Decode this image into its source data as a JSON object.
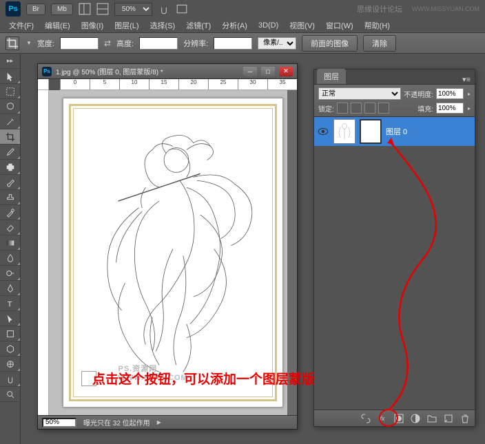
{
  "header": {
    "logo": "Ps",
    "br": "Br",
    "mb": "Mb",
    "zoom": "50%",
    "brand": "思缘设计论坛",
    "brand_url": "WWW.MISSYUAN.COM"
  },
  "menu": {
    "file": "文件(F)",
    "edit": "编辑(E)",
    "image": "图像(I)",
    "layer": "图层(L)",
    "select": "选择(S)",
    "filter": "滤镜(T)",
    "analysis": "分析(A)",
    "3d": "3D(D)",
    "view": "视图(V)",
    "window": "窗口(W)",
    "help": "帮助(H)"
  },
  "options": {
    "width_label": "宽度:",
    "height_label": "高度:",
    "resolution_label": "分辨率:",
    "unit": "像素/...",
    "front_image": "前面的图像",
    "clear": "清除"
  },
  "document": {
    "title": "1.jpg @ 50% (图层 0, 图层蒙版/8) *",
    "rulers": [
      "0",
      "5",
      "10",
      "15",
      "20",
      "25",
      "30",
      "35"
    ],
    "status_zoom": "50%",
    "status_text": "曝光只在 32 位起作用",
    "watermark": "PS.资源网  WWW.86PS.COM"
  },
  "layers": {
    "tab": "图层",
    "blend_mode": "正常",
    "opacity_label": "不透明度:",
    "opacity_value": "100%",
    "lock_label": "锁定:",
    "fill_label": "填充:",
    "fill_value": "100%",
    "layer0_name": "图层 0"
  },
  "annotation": {
    "text": "点击这个按钮，可以添加一个图层蒙版"
  }
}
